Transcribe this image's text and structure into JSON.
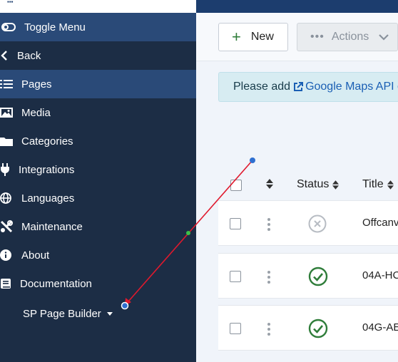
{
  "sidebar": {
    "toggle_label": "Toggle Menu",
    "items": [
      {
        "label": "Back",
        "icon": "chevron-left-icon"
      },
      {
        "label": "Pages",
        "icon": "list-icon",
        "active": true
      },
      {
        "label": "Media",
        "icon": "image-icon"
      },
      {
        "label": "Categories",
        "icon": "folder-icon"
      },
      {
        "label": "Integrations",
        "icon": "plug-icon"
      },
      {
        "label": "Languages",
        "icon": "globe-icon"
      },
      {
        "label": "Maintenance",
        "icon": "tools-icon"
      },
      {
        "label": "About",
        "icon": "info-icon"
      },
      {
        "label": "Documentation",
        "icon": "book-icon"
      },
      {
        "label": "SP Page Builder",
        "icon": "caret-down-icon"
      }
    ]
  },
  "toolbar": {
    "new_label": "New",
    "actions_label": "Actions"
  },
  "alert": {
    "prefix": "Please add",
    "link_text": "Google Maps API c"
  },
  "table": {
    "headers": {
      "status": "Status",
      "title": "Title"
    },
    "rows": [
      {
        "status": "unpublished",
        "title": "Offcanv"
      },
      {
        "status": "published",
        "title": "04A-HC"
      },
      {
        "status": "published",
        "title": "04G-AE"
      }
    ]
  },
  "colors": {
    "sidebar_bg": "#1c2d45",
    "sidebar_active": "#2a4a78",
    "published_green": "#2f7d3a",
    "annotation_arrow": "#e0192d"
  }
}
